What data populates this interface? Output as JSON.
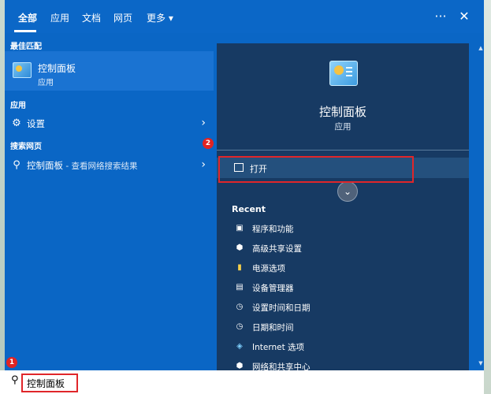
{
  "tabs": [
    {
      "label": "全部",
      "active": true
    },
    {
      "label": "应用"
    },
    {
      "label": "文档"
    },
    {
      "label": "网页"
    },
    {
      "label": "更多"
    }
  ],
  "left": {
    "best_match_title": "最佳匹配",
    "best_match": {
      "name": "控制面板",
      "type": "应用"
    },
    "apps_title": "应用",
    "apps": [
      {
        "label": "设置",
        "icon": "gear-icon"
      }
    ],
    "web_title": "搜索网页",
    "web": {
      "query": "控制面板",
      "suffix": " - 查看网络搜索结果",
      "icon": "search-icon"
    }
  },
  "right": {
    "title": "控制面板",
    "subtitle": "应用",
    "open_label": "打开",
    "recent_title": "Recent",
    "recent": [
      {
        "label": "程序和功能",
        "icon": "programs-icon"
      },
      {
        "label": "高级共享设置",
        "icon": "network-icon"
      },
      {
        "label": "电源选项",
        "icon": "power-icon"
      },
      {
        "label": "设备管理器",
        "icon": "device-manager-icon"
      },
      {
        "label": "设置时间和日期",
        "icon": "clock-icon"
      },
      {
        "label": "日期和时间",
        "icon": "clock-icon"
      },
      {
        "label": "Internet 选项",
        "icon": "internet-icon"
      },
      {
        "label": "网络和共享中心",
        "icon": "network-icon"
      }
    ]
  },
  "annotations": {
    "badge1": "1",
    "badge2": "2"
  },
  "search": {
    "value": "控制面板"
  },
  "colors": {
    "accent": "#0a66c5",
    "panel": "#173a63",
    "highlight": "#e0262a"
  }
}
